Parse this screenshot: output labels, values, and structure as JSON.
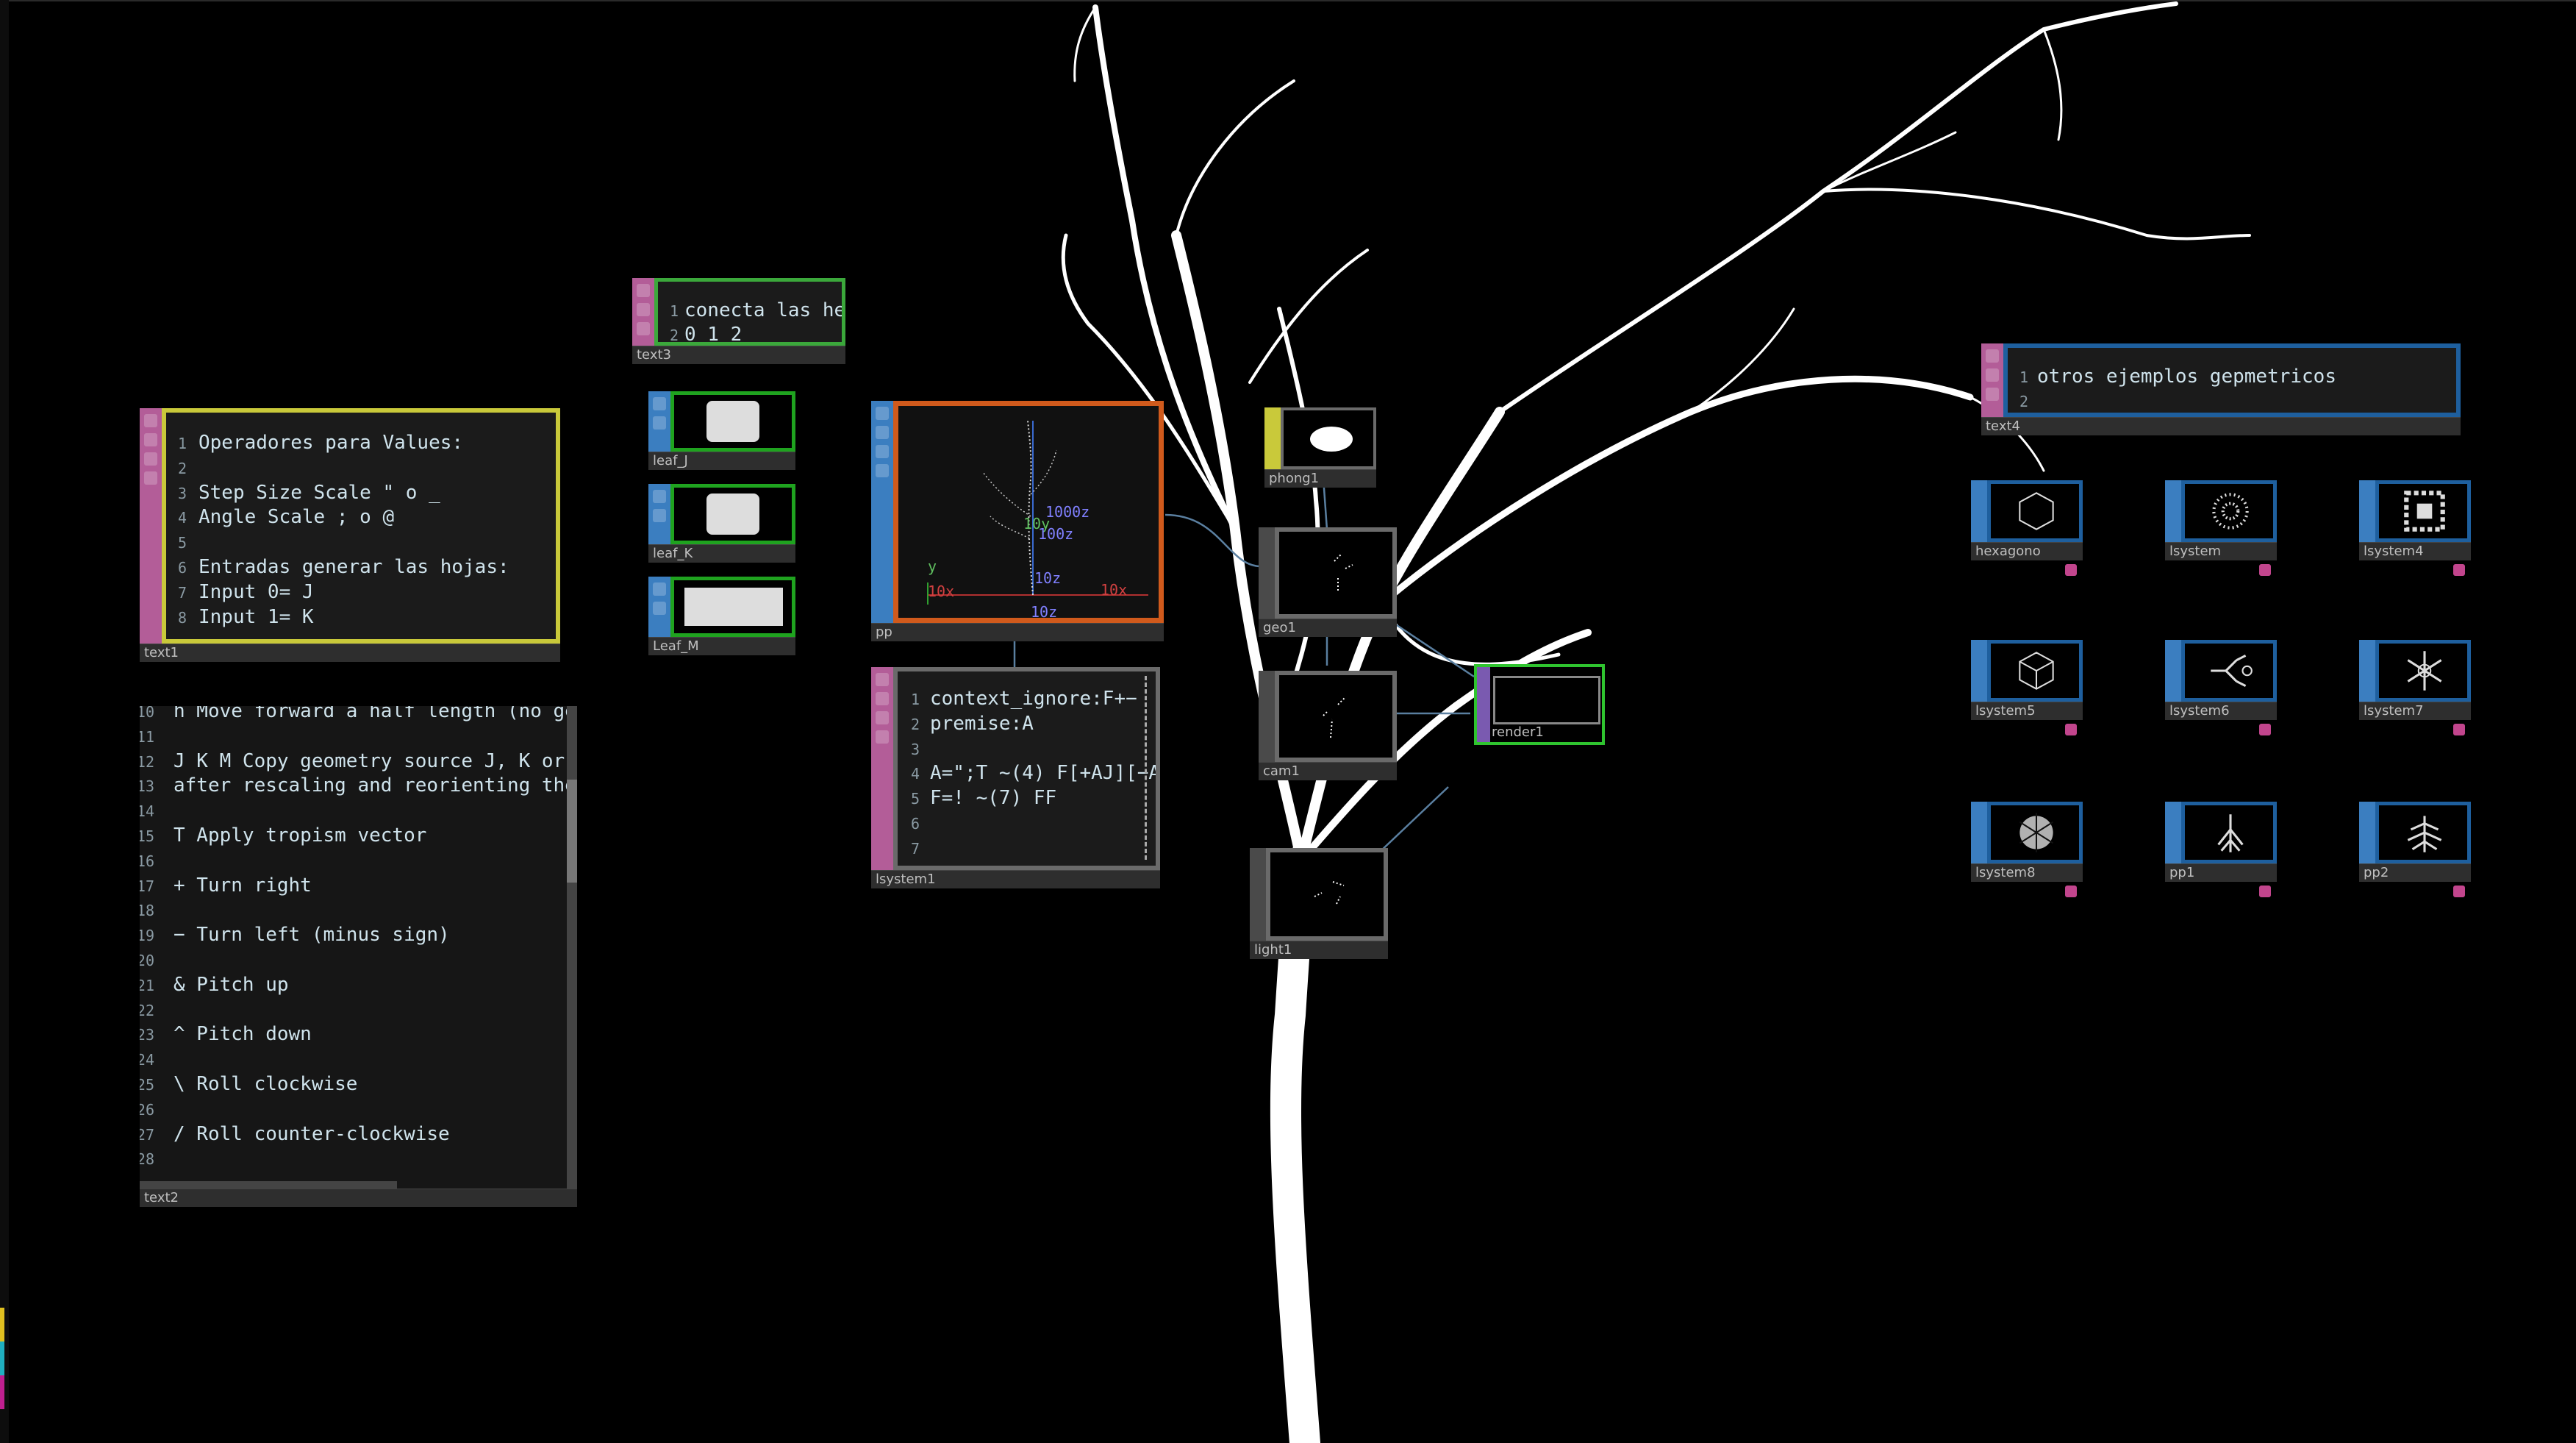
{
  "nodes": {
    "text1": {
      "name": "text1",
      "lines": [
        {
          "n": "1",
          "t": "Operadores para Values:"
        },
        {
          "n": "2",
          "t": ""
        },
        {
          "n": "3",
          "t": "Step Size Scale \" o _"
        },
        {
          "n": "4",
          "t": "Angle Scale ; o @"
        },
        {
          "n": "5",
          "t": ""
        },
        {
          "n": "6",
          "t": "Entradas generar las hojas:"
        },
        {
          "n": "7",
          "t": "Input 0= J"
        },
        {
          "n": "8",
          "t": "Input 1= K"
        }
      ]
    },
    "text2": {
      "name": "text2",
      "lines": [
        {
          "n": "10",
          "t": "h Move forward a half length (no geome"
        },
        {
          "n": "11",
          "t": ""
        },
        {
          "n": "12",
          "t": "J K M Copy geometry source J, K or M a"
        },
        {
          "n": "13",
          "t": "after rescaling and reorienting the ge"
        },
        {
          "n": "14",
          "t": ""
        },
        {
          "n": "15",
          "t": "T Apply tropism vector"
        },
        {
          "n": "16",
          "t": ""
        },
        {
          "n": "17",
          "t": "+ Turn right"
        },
        {
          "n": "18",
          "t": ""
        },
        {
          "n": "19",
          "t": "− Turn left (minus sign)"
        },
        {
          "n": "20",
          "t": ""
        },
        {
          "n": "21",
          "t": "& Pitch up"
        },
        {
          "n": "22",
          "t": ""
        },
        {
          "n": "23",
          "t": "^ Pitch down"
        },
        {
          "n": "24",
          "t": ""
        },
        {
          "n": "25",
          "t": "\\ Roll clockwise"
        },
        {
          "n": "26",
          "t": ""
        },
        {
          "n": "27",
          "t": "/ Roll counter-clockwise"
        },
        {
          "n": "28",
          "t": ""
        }
      ]
    },
    "text3": {
      "name": "text3",
      "lines": [
        {
          "n": "1",
          "t": "conecta las he"
        },
        {
          "n": "2",
          "t": "0 1 2"
        }
      ]
    },
    "text4": {
      "name": "text4",
      "lines": [
        {
          "n": "1",
          "t": "otros ejemplos gepmetricos"
        },
        {
          "n": "2",
          "t": ""
        }
      ]
    },
    "lsystem1": {
      "name": "lsystem1",
      "lines": [
        {
          "n": "1",
          "t": "context_ignore:F+−"
        },
        {
          "n": "2",
          "t": "premise:A"
        },
        {
          "n": "3",
          "t": ""
        },
        {
          "n": "4",
          "t": "A=\";T ~(4) F[+AJ][−A"
        },
        {
          "n": "5",
          "t": "F=! ~(7) FF"
        },
        {
          "n": "6",
          "t": ""
        },
        {
          "n": "7",
          "t": ""
        }
      ]
    },
    "pp": {
      "name": "pp",
      "viewer_labels": [
        "1000z",
        "10y",
        "100z",
        "10z",
        "10x",
        "10x",
        "10z",
        "y"
      ]
    },
    "leaf_J": {
      "name": "leaf_J"
    },
    "leaf_K": {
      "name": "leaf_K"
    },
    "leaf_M": {
      "name": "Leaf_M"
    },
    "phong1": {
      "name": "phong1"
    },
    "geo1": {
      "name": "geo1"
    },
    "cam1": {
      "name": "cam1"
    },
    "light1": {
      "name": "light1"
    },
    "render1": {
      "name": "render1"
    },
    "examples": [
      {
        "name": "hexagono",
        "icon": "hexagon-icon"
      },
      {
        "name": "lsystem",
        "icon": "dotted-rosette-icon"
      },
      {
        "name": "lsystem4",
        "icon": "square-fractal-icon"
      },
      {
        "name": "lsystem5",
        "icon": "cube-icon"
      },
      {
        "name": "lsystem6",
        "icon": "branching-fractal-icon"
      },
      {
        "name": "lsystem7",
        "icon": "snowflake-icon"
      },
      {
        "name": "lsystem8",
        "icon": "dense-snowflake-icon"
      },
      {
        "name": "pp1",
        "icon": "fractal-tree-icon"
      },
      {
        "name": "pp2",
        "icon": "fern-leaf-icon"
      }
    ]
  },
  "colors": {
    "canvas": "#000000",
    "text_dat_strip": "#b35d98",
    "text1_border": "#c9c93a",
    "text3_border": "#3ba83b",
    "leaf_border": "#1fa31f",
    "pp_border": "#d05a1c",
    "sop_strip": "#3b7ec0",
    "comp_border": "#6a6a6a",
    "render_border": "#2fc42f",
    "examples_border": "#1e5f9e",
    "wire": "#5a7fa0"
  }
}
